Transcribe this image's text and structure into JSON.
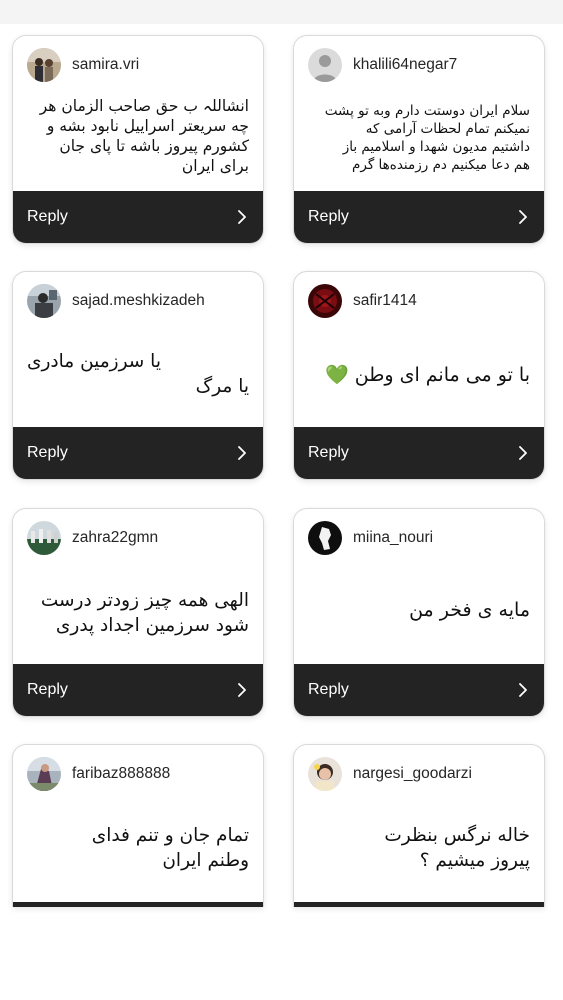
{
  "reply_label": "Reply",
  "cards": [
    {
      "username": "samira.vri",
      "avatar_icon": "photo-avatar",
      "comment_lines": [
        "انشاللہ ب حق صاحب الزمان هر",
        "چه سریعتر اسراییل نابود بشه و",
        "کشورم پیروز باشه  تا پای جان",
        "برای ایران"
      ]
    },
    {
      "username": "khalili64negar7",
      "avatar_icon": "default-user-avatar",
      "comment_lines": [
        "سلام ایران دوستت دارم وبه تو پشت",
        "نمیکنم تمام لحظات آرامی که",
        "داشتیم مدیون شهدا و اسلامیم باز",
        "هم دعا میکنیم دم رزمنده‌ها گرم"
      ]
    },
    {
      "username": "sajad.meshkizadeh",
      "avatar_icon": "photo-avatar",
      "comment_lines": [
        "یا سرزمین مادری",
        "یا مرگ"
      ]
    },
    {
      "username": "safir1414",
      "avatar_icon": "photo-avatar",
      "comment_lines": [
        "با تو می مانم ای وطن 💚"
      ]
    },
    {
      "username": "zahra22gmn",
      "avatar_icon": "photo-avatar",
      "comment_lines": [
        "الهی همه چیز زودتر درست",
        "شود سرزمین اجداد پدری"
      ]
    },
    {
      "username": "miina_nouri",
      "avatar_icon": "photo-avatar",
      "comment_lines": [
        "مایه ی فخر من"
      ]
    },
    {
      "username": "faribaz888888",
      "avatar_icon": "photo-avatar",
      "comment_lines": [
        "تمام جان و تنم فدای",
        "وطنم ایران"
      ]
    },
    {
      "username": "nargesi_goodarzi",
      "avatar_icon": "photo-avatar",
      "comment_lines": [
        "خاله نرگس بنظرت",
        "پیروز میشیم ؟"
      ]
    }
  ],
  "colors": {
    "reply_bar": "#232323",
    "card_border": "#d9d9d9",
    "heart": "#33cc33"
  }
}
